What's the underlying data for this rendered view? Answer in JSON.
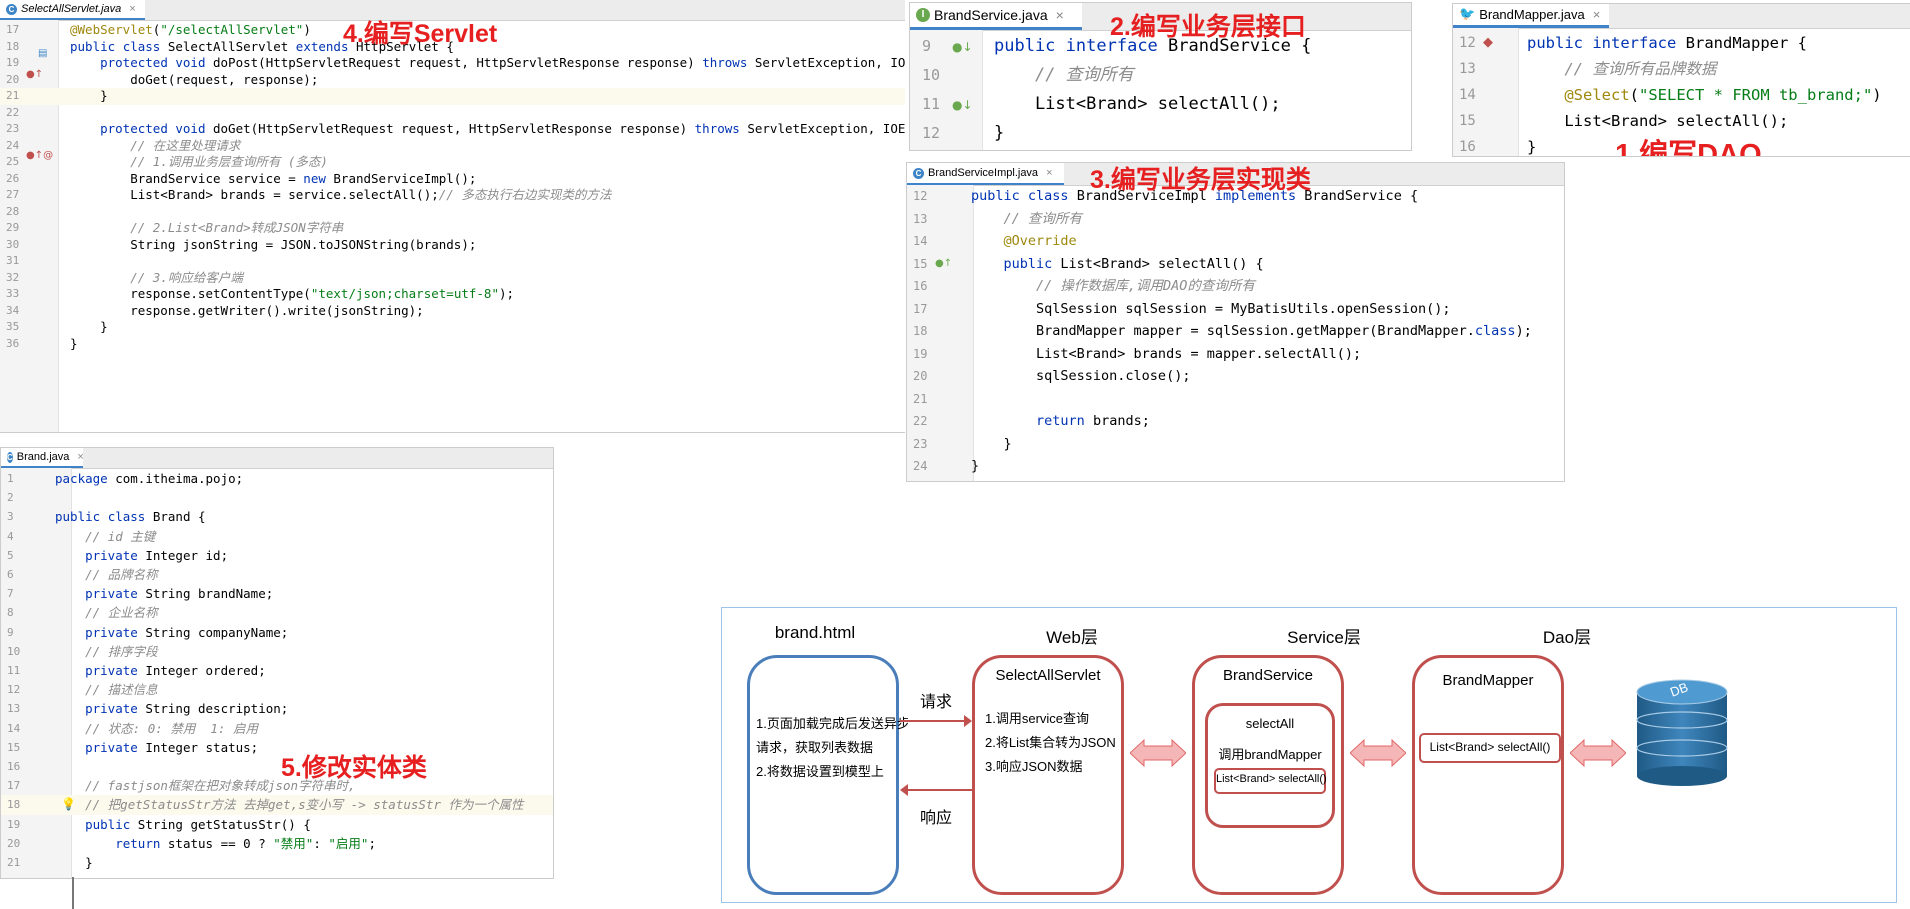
{
  "servlet_pane": {
    "tab": "SelectAllServlet.java",
    "title": "4.编写Servlet",
    "lines": [
      {
        "n": "17",
        "t": "@WebServlet(\"/selectAllServlet\")"
      },
      {
        "n": "18",
        "t": "public class SelectAllServlet extends HttpServlet {"
      },
      {
        "n": "19",
        "t": "    protected void doPost(HttpServletRequest request, HttpServletResponse response) throws ServletException, IOException {"
      },
      {
        "n": "20",
        "t": "        doGet(request, response);"
      },
      {
        "n": "21",
        "t": "    }"
      },
      {
        "n": "22",
        "t": ""
      },
      {
        "n": "23",
        "t": "    protected void doGet(HttpServletRequest request, HttpServletResponse response) throws ServletException, IOException {"
      },
      {
        "n": "24",
        "t": "        // 在这里处理请求"
      },
      {
        "n": "25",
        "t": "        // 1.调用业务层查询所有 (多态)"
      },
      {
        "n": "26",
        "t": "        BrandService service = new BrandServiceImpl();"
      },
      {
        "n": "27",
        "t": "        List<Brand> brands = service.selectAll();// 多态执行右边实现类的方法"
      },
      {
        "n": "28",
        "t": ""
      },
      {
        "n": "29",
        "t": "        // 2.List<Brand>转成JSON字符串"
      },
      {
        "n": "30",
        "t": "        String jsonString = JSON.toJSONString(brands);"
      },
      {
        "n": "31",
        "t": ""
      },
      {
        "n": "32",
        "t": "        // 3.响应给客户端"
      },
      {
        "n": "33",
        "t": "        response.setContentType(\"text/json;charset=utf-8\");"
      },
      {
        "n": "34",
        "t": "        response.getWriter().write(jsonString);"
      },
      {
        "n": "35",
        "t": "    }"
      },
      {
        "n": "36",
        "t": "}"
      }
    ]
  },
  "service_pane": {
    "tab": "BrandService.java",
    "title": "2.编写业务层接口",
    "lines": [
      {
        "n": "9",
        "t": "public interface BrandService {"
      },
      {
        "n": "10",
        "t": "    // 查询所有"
      },
      {
        "n": "11",
        "t": "    List<Brand> selectAll();"
      },
      {
        "n": "12",
        "t": "}"
      }
    ]
  },
  "mapper_pane": {
    "tab": "BrandMapper.java",
    "title": "1.编写DAO",
    "lines": [
      {
        "n": "12",
        "t": "public interface BrandMapper {"
      },
      {
        "n": "13",
        "t": "    // 查询所有品牌数据"
      },
      {
        "n": "14",
        "t": "    @Select(\"SELECT * FROM tb_brand;\")"
      },
      {
        "n": "15",
        "t": "    List<Brand> selectAll();"
      },
      {
        "n": "16",
        "t": "}"
      }
    ]
  },
  "impl_pane": {
    "tab": "BrandServiceImpl.java",
    "title": "3.编写业务层实现类",
    "lines": [
      {
        "n": "12",
        "t": "public class BrandServiceImpl implements BrandService {"
      },
      {
        "n": "13",
        "t": "    // 查询所有"
      },
      {
        "n": "14",
        "t": "    @Override"
      },
      {
        "n": "15",
        "t": "    public List<Brand> selectAll() {"
      },
      {
        "n": "16",
        "t": "        // 操作数据库,调用DAO的查询所有"
      },
      {
        "n": "17",
        "t": "        SqlSession sqlSession = MyBatisUtils.openSession();"
      },
      {
        "n": "18",
        "t": "        BrandMapper mapper = sqlSession.getMapper(BrandMapper.class);"
      },
      {
        "n": "19",
        "t": "        List<Brand> brands = mapper.selectAll();"
      },
      {
        "n": "20",
        "t": "        sqlSession.close();"
      },
      {
        "n": "21",
        "t": ""
      },
      {
        "n": "22",
        "t": "        return brands;"
      },
      {
        "n": "23",
        "t": "    }"
      },
      {
        "n": "24",
        "t": "}"
      }
    ]
  },
  "brand_pane": {
    "tab": "Brand.java",
    "title": "5.修改实体类",
    "lines": [
      {
        "n": "1",
        "t": "package com.itheima.pojo;"
      },
      {
        "n": "2",
        "t": ""
      },
      {
        "n": "3",
        "t": "public class Brand {"
      },
      {
        "n": "4",
        "t": "    // id 主键"
      },
      {
        "n": "5",
        "t": "    private Integer id;"
      },
      {
        "n": "6",
        "t": "    // 品牌名称"
      },
      {
        "n": "7",
        "t": "    private String brandName;"
      },
      {
        "n": "8",
        "t": "    // 企业名称"
      },
      {
        "n": "9",
        "t": "    private String companyName;"
      },
      {
        "n": "10",
        "t": "    // 排序字段"
      },
      {
        "n": "11",
        "t": "    private Integer ordered;"
      },
      {
        "n": "12",
        "t": "    // 描述信息"
      },
      {
        "n": "13",
        "t": "    private String description;"
      },
      {
        "n": "14",
        "t": "    // 状态: 0: 禁用  1: 启用"
      },
      {
        "n": "15",
        "t": "    private Integer status;"
      },
      {
        "n": "16",
        "t": ""
      },
      {
        "n": "17",
        "t": "    // fastjson框架在把对象转成json字符串时,"
      },
      {
        "n": "18",
        "t": "    // 把getStatusStr方法 去掉get,s变小写 -> statusStr 作为一个属性"
      },
      {
        "n": "19",
        "t": "    public String getStatusStr() {"
      },
      {
        "n": "20",
        "t": "        return status == 0 ? \"禁用\": \"启用\";"
      },
      {
        "n": "21",
        "t": "    }"
      }
    ]
  },
  "diagram": {
    "headers": {
      "html": "brand.html",
      "web": "Web层",
      "service": "Service层",
      "dao": "Dao层"
    },
    "html_box": {
      "line1": "1.页面加载完成后发送异步",
      "line2": "请求，获取列表数据",
      "line3": "2.将数据设置到模型上"
    },
    "request_label": "请求",
    "response_label": "响应",
    "web_box": {
      "title": "SelectAllServlet",
      "s1": "1.调用service查询",
      "s2": "2.将List集合转为JSON",
      "s3": "3.响应JSON数据"
    },
    "service_box": {
      "title": "BrandService",
      "inner_title": "selectAll",
      "inner_text": "调用brandMapper",
      "method": "List<Brand> selectAll()"
    },
    "dao_box": {
      "title": "BrandMapper",
      "method": "List<Brand> selectAll()"
    },
    "db_label": "DB",
    "colors": {
      "html_border": "#4a7ebb",
      "box_border": "#c0504d",
      "arrow_fill": "#f4b6b6",
      "db_fill": "#2e6f9e"
    }
  }
}
